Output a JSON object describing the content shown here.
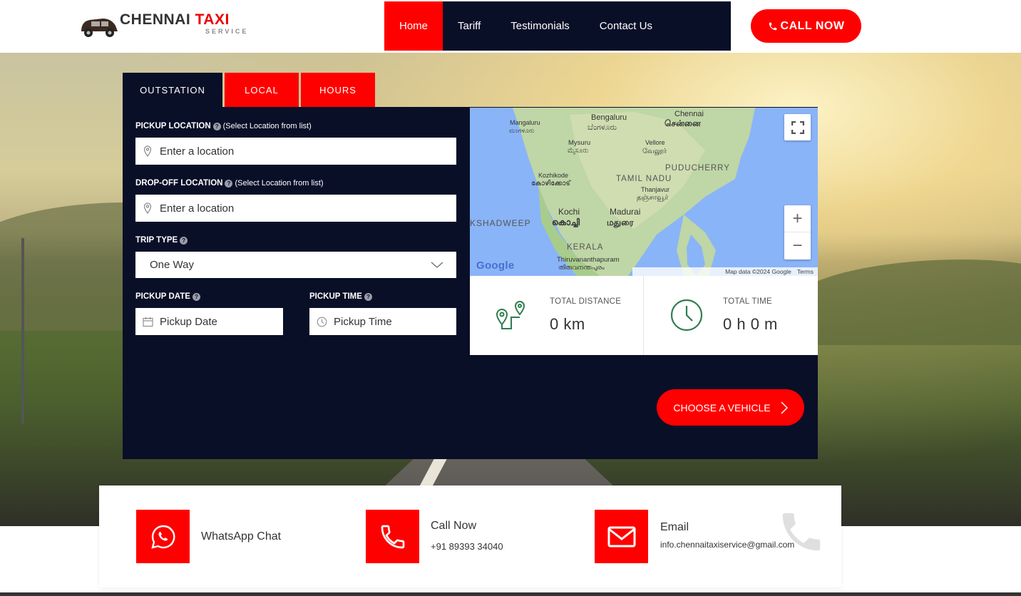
{
  "brand": {
    "name_part1": "CHENNAI",
    "name_part2": "TAXI",
    "tagline": "SERVICE"
  },
  "nav": {
    "items": [
      "Home",
      "Tariff",
      "Testimonials",
      "Contact Us"
    ],
    "active": "Home"
  },
  "call_button": {
    "label": "CALL NOW"
  },
  "booking": {
    "tabs": [
      "OUTSTATION",
      "LOCAL",
      "HOURS"
    ],
    "pickup_label": "PICKUP LOCATION",
    "dropoff_label": "DROP-OFF LOCATION",
    "select_note": "(Select Location from list)",
    "location_placeholder": "Enter a location",
    "trip_type_label": "TRIP TYPE",
    "trip_type_value": "One Way",
    "pickup_date_label": "PICKUP DATE",
    "pickup_date_placeholder": "Pickup Date",
    "pickup_time_label": "PICKUP TIME",
    "pickup_time_placeholder": "Pickup Time",
    "choose_label": "CHOOSE A VEHICLE"
  },
  "map": {
    "labels": [
      {
        "text": "Bengaluru"
      },
      {
        "text": "ಬೆಂಗಳೂರು"
      },
      {
        "text": "Chennai"
      },
      {
        "text": "சென்னை"
      },
      {
        "text": "Mangaluru"
      },
      {
        "text": "ಮಂಗಳೂರು"
      },
      {
        "text": "Mysuru"
      },
      {
        "text": "ಮೈಸೂರು"
      },
      {
        "text": "Vellore"
      },
      {
        "text": "வேலூர்"
      },
      {
        "text": "PUDUCHERRY"
      },
      {
        "text": "Kozhikode"
      },
      {
        "text": "കോഴിക്കോട്"
      },
      {
        "text": "TAMIL NADU"
      },
      {
        "text": "Thanjavur"
      },
      {
        "text": "தஞ்சாவூர்"
      },
      {
        "text": "Kochi"
      },
      {
        "text": "കൊച്ചി"
      },
      {
        "text": "Madurai"
      },
      {
        "text": "மதுரை"
      },
      {
        "text": "KSHADWEEP"
      },
      {
        "text": "KERALA"
      },
      {
        "text": "Thiruvananthapuram"
      },
      {
        "text": "തിരുവനന്തപുരം"
      }
    ],
    "google": "Google",
    "attribution": "Map data ©2024 Google",
    "terms": "Terms",
    "zoom_in": "+",
    "zoom_out": "−"
  },
  "stats": {
    "distance_label": "TOTAL DISTANCE",
    "distance_value": "0 km",
    "time_label": "TOTAL TIME",
    "time_value": "0 h 0 m"
  },
  "contact": {
    "whatsapp_label": "WhatsApp Chat",
    "call_label": "Call Now",
    "call_number": "+91 89393 34040",
    "email_label": "Email",
    "email_address": "info.chennaitaxiservice@gmail.com"
  },
  "colors": {
    "accent": "#ff0000",
    "navy": "#0a0f28",
    "icon_green": "#2e7d4f"
  }
}
